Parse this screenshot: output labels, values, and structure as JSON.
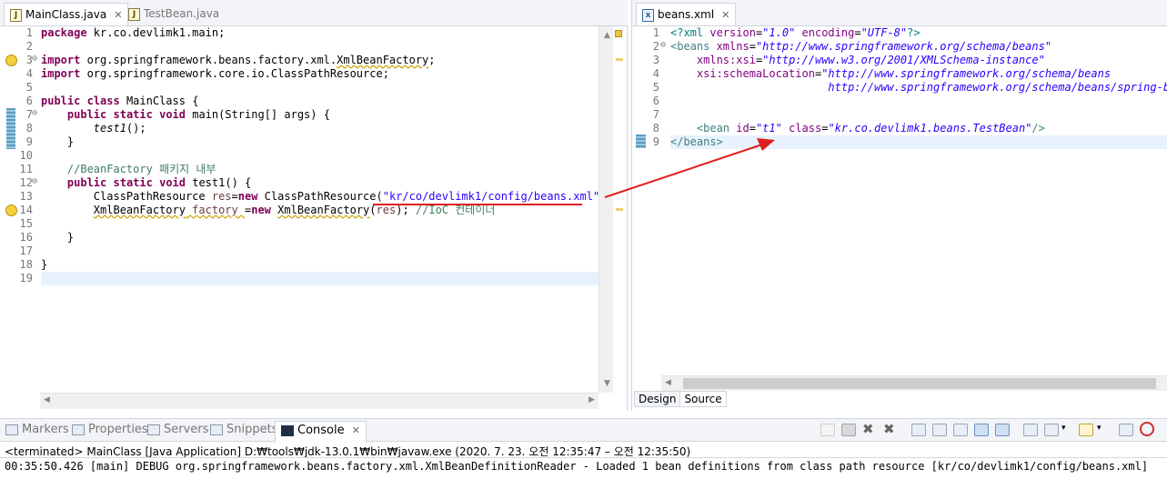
{
  "left_editor": {
    "tabs": [
      {
        "label": "MainClass.java",
        "close": "✕",
        "active": true
      },
      {
        "label": "TestBean.java",
        "close": "",
        "active": false
      }
    ],
    "line_numbers": [
      "1",
      "2",
      "3",
      "4",
      "5",
      "6",
      "7",
      "8",
      "9",
      "10",
      "11",
      "12",
      "13",
      "14",
      "15",
      "16",
      "17",
      "18",
      "19"
    ],
    "fold_markers": {
      "3": "⊖",
      "7": "⊖",
      "12": "⊖"
    },
    "code": {
      "l1_kw": "package",
      "l1_rest": " kr.co.devlimk1.main;",
      "l3_kw": "import",
      "l3_pre": " org.springframework.beans.factory.xml.",
      "l3_dep": "XmlBeanFactory",
      "l3_end": ";",
      "l4_kw": "import",
      "l4_rest": " org.springframework.core.io.ClassPathResource;",
      "l6_kw1": "public",
      "l6_kw2": "class",
      "l6_rest": " MainClass {",
      "l7_kw1": "public",
      "l7_kw2": "static",
      "l7_kw3": "void",
      "l7_rest": " main(String[] args) {",
      "l8_call": "test1",
      "l8_rest": "();",
      "l9": "}",
      "l11": "//BeanFactory 패키지 내부",
      "l12_kw1": "public",
      "l12_kw2": "static",
      "l12_kw3": "void",
      "l12_rest": " test1() {",
      "l13_a": "ClassPathResource ",
      "l13_var": "res",
      "l13_b": "=",
      "l13_kw": "new",
      "l13_c": " ClassPathResource(",
      "l13_str": "\"kr/co/devlimk1/config/beans.xml\"",
      "l13_d": ");",
      "l14_dep1": "XmlBeanFactory",
      "l14_var": " factory ",
      "l14_b": "=",
      "l14_kw": "new",
      "l14_sp": " ",
      "l14_dep2": "XmlBeanFactory",
      "l14_c": "(",
      "l14_arg": "res",
      "l14_d": "); ",
      "l14_cm": "//IoC 컨테이너",
      "l16": "}",
      "l18": "}"
    }
  },
  "right_editor": {
    "tab": {
      "label": "beans.xml",
      "close": "✕"
    },
    "line_numbers": [
      "1",
      "2",
      "3",
      "4",
      "5",
      "6",
      "7",
      "8",
      "9"
    ],
    "fold_markers": {
      "2": "⊖"
    },
    "xml": {
      "l1_a": "<?xml ",
      "l1_attr1": "version",
      "l1_eq1": "=",
      "l1_val1": "\"1.0\"",
      "l1_sp": " ",
      "l1_attr2": "encoding",
      "l1_eq2": "=",
      "l1_val2": "\"UTF-8\"",
      "l1_end": "?>",
      "l2_tag": "<beans ",
      "l2_attr": "xmlns",
      "l2_eq": "=",
      "l2_val": "\"http://www.springframework.org/schema/beans\"",
      "l3_attr": "xmlns:xsi",
      "l3_eq": "=",
      "l3_val": "\"http://www.w3.org/2001/XMLSchema-instance\"",
      "l4_attr": "xsi:schemaLocation",
      "l4_eq": "=",
      "l4_val": "\"http://www.springframework.org/schema/beans",
      "l5_val": "http://www.springframework.org/schema/beans/spring-bea",
      "l8_tag": "<bean ",
      "l8_attr1": "id",
      "l8_eq1": "=",
      "l8_val1": "\"t1\"",
      "l8_sp": " ",
      "l8_attr2": "class",
      "l8_eq2": "=",
      "l8_val2": "\"kr.co.devlimk1.beans.TestBean\"",
      "l8_end": "/>",
      "l9_tag": "</beans>"
    },
    "bottom_tabs": {
      "design": "Design",
      "source": "Source",
      "active": "Source"
    }
  },
  "bottom_panel": {
    "tabs": [
      {
        "label": "Markers",
        "icon": "markers-icon"
      },
      {
        "label": "Properties",
        "icon": "properties-icon"
      },
      {
        "label": "Servers",
        "icon": "servers-icon"
      },
      {
        "label": "Snippets",
        "icon": "snippets-icon"
      },
      {
        "label": "Console",
        "icon": "console-icon",
        "active": true,
        "close": "✕"
      }
    ],
    "status": "<terminated> MainClass [Java Application] D:₩tools₩jdk-13.0.1₩bin₩javaw.exe  (2020. 7. 23. 오전 12:35:47 – 오전 12:35:50)",
    "output": "00:35:50.426 [main] DEBUG org.springframework.beans.factory.xml.XmlBeanDefinitionReader - Loaded 1 bean definitions from class path resource [kr/co/devlimk1/config/beans.xml]"
  },
  "colors": {
    "annotation": "#e0201f",
    "keyword": "#7f0055",
    "string": "#2a00ff",
    "comment": "#3f7f5f",
    "current_line": "#e8f2fe"
  }
}
